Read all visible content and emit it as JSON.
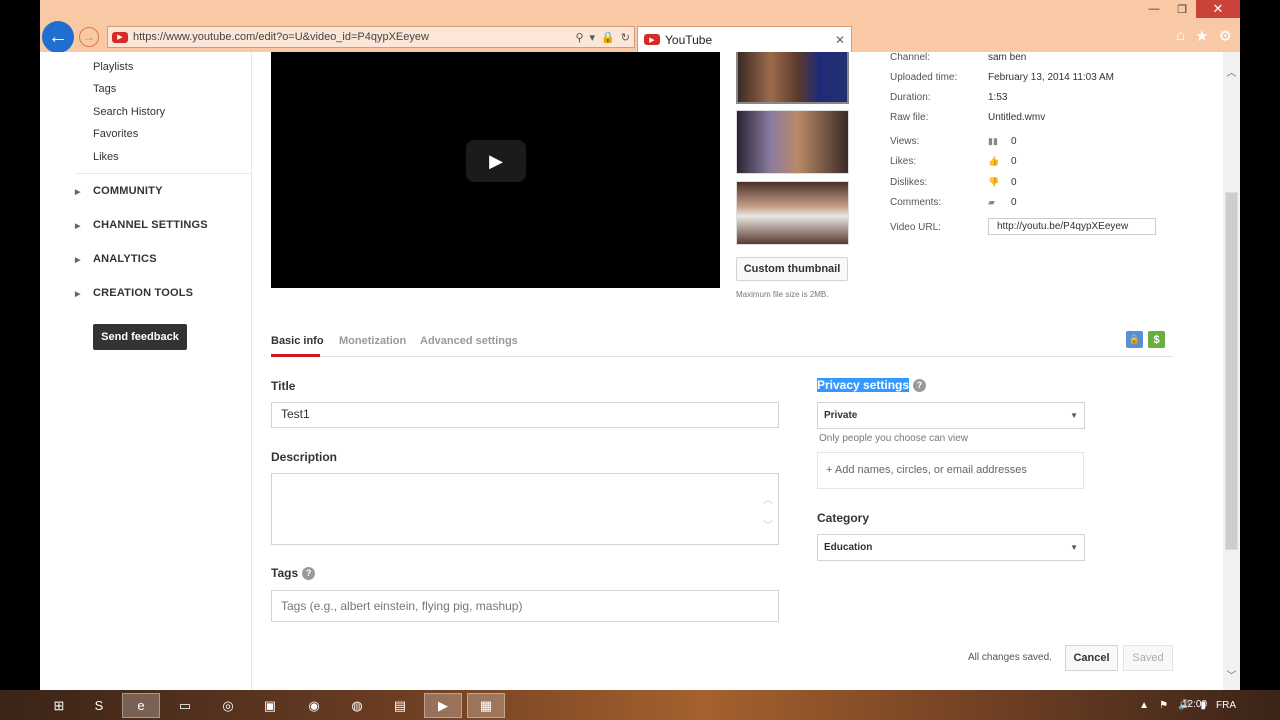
{
  "browser": {
    "url": "https://www.youtube.com/edit?o=U&video_id=P4qypXEeyew",
    "tab_title": "YouTube",
    "win_minimize": "—",
    "win_restore": "❐",
    "win_close": "✕"
  },
  "sidebar": {
    "links": [
      "Playlists",
      "Tags",
      "Search History",
      "Favorites",
      "Likes"
    ],
    "sections": [
      "COMMUNITY",
      "CHANNEL SETTINGS",
      "ANALYTICS",
      "CREATION TOOLS"
    ],
    "feedback": "Send feedback"
  },
  "video": {
    "custom_thumbnail": "Custom thumbnail",
    "max_file_size": "Maximum file size is 2MB."
  },
  "meta": {
    "channel_label": "Channel:",
    "channel": "sam ben",
    "uploaded_label": "Uploaded time:",
    "uploaded": "February 13, 2014 11:03 AM",
    "duration_label": "Duration:",
    "duration": "1:53",
    "raw_label": "Raw file:",
    "raw": "Untitled.wmv",
    "views_label": "Views:",
    "views": "0",
    "likes_label": "Likes:",
    "likes": "0",
    "dislikes_label": "Dislikes:",
    "dislikes": "0",
    "comments_label": "Comments:",
    "comments": "0",
    "url_label": "Video URL:",
    "video_url": "http://youtu.be/P4qypXEeyew"
  },
  "tabs": [
    "Basic info",
    "Monetization",
    "Advanced settings"
  ],
  "form": {
    "title_label": "Title",
    "title_value": "Test1",
    "description_label": "Description",
    "tags_label": "Tags",
    "tags_placeholder": "Tags (e.g., albert einstein, flying pig, mashup)",
    "privacy_label": "Privacy settings",
    "privacy_value": "Private",
    "privacy_hint": "Only people you choose can view",
    "add_people": "+ Add names, circles, or email addresses",
    "category_label": "Category",
    "category_value": "Education",
    "status": "All changes saved.",
    "cancel": "Cancel",
    "saved": "Saved"
  },
  "taskbar": {
    "lang": "FRA",
    "time": "12:00"
  }
}
